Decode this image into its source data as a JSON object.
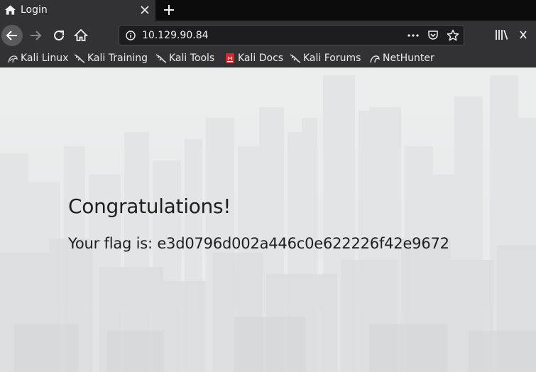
{
  "browser": {
    "tab": {
      "title": "Login",
      "icon": "home-icon"
    },
    "address_bar": {
      "url": "10.129.90.84"
    },
    "bookmarks": [
      {
        "label": "Kali Linux",
        "icon": "kali-dragon-icon"
      },
      {
        "label": "Kali Training",
        "icon": "kali-dragon-icon"
      },
      {
        "label": "Kali Tools",
        "icon": "kali-dragon-icon"
      },
      {
        "label": "Kali Docs",
        "icon": "kali-docs-icon"
      },
      {
        "label": "Kali Forums",
        "icon": "kali-dragon-icon"
      },
      {
        "label": "NetHunter",
        "icon": "nethunter-icon"
      }
    ]
  },
  "page": {
    "heading": "Congratulations!",
    "flag_text": "Your flag is: e3d0796d002a446c0e622226f42e9672"
  },
  "colors": {
    "tab_strip": "#0c0c0d",
    "toolbar": "#323234",
    "urlbar": "#1d1d1f",
    "page_text": "#1f1f1f",
    "page_background": "#e8e9eb"
  }
}
